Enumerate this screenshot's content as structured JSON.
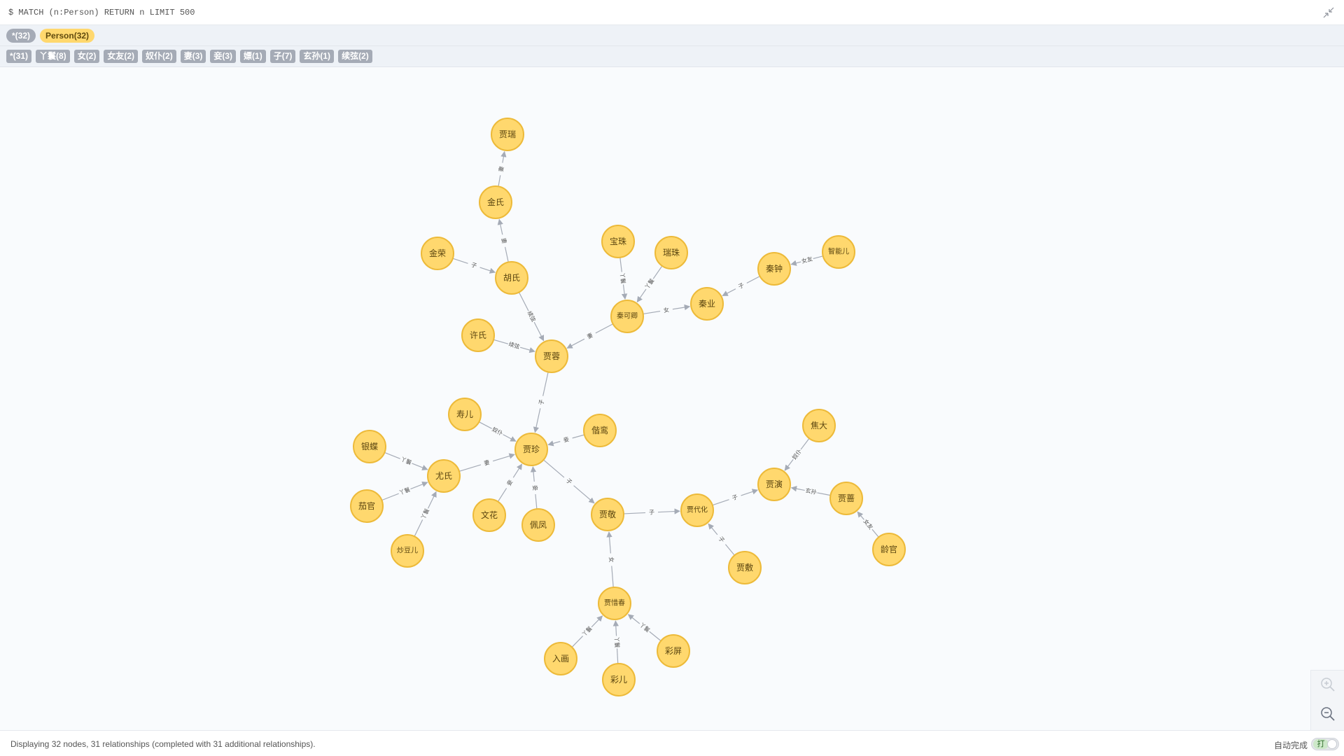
{
  "query": {
    "text": "$ MATCH (n:Person) RETURN n LIMIT 500"
  },
  "labels": [
    {
      "text": "*(32)",
      "kind": "all"
    },
    {
      "text": "Person(32)",
      "kind": "person"
    }
  ],
  "relationship_types": [
    "*(31)",
    "丫鬟(8)",
    "女(2)",
    "女友(2)",
    "奴仆(2)",
    "妻(3)",
    "妾(3)",
    "嫖(1)",
    "子(7)",
    "玄孙(1)",
    "续弦(2)"
  ],
  "graph": {
    "node_color": "#ffd86e",
    "node_border_color": "#edba39",
    "edge_color": "#a5abb6",
    "nodes": [
      {
        "id": "jiarui",
        "name": "贾瑞"
      },
      {
        "id": "jinshi",
        "name": "金氏"
      },
      {
        "id": "jinrong",
        "name": "金荣"
      },
      {
        "id": "hushi",
        "name": "胡氏"
      },
      {
        "id": "baozhu",
        "name": "宝珠"
      },
      {
        "id": "ruizhu",
        "name": "瑞珠"
      },
      {
        "id": "zhinenger",
        "name": "智能儿"
      },
      {
        "id": "qinzhong",
        "name": "秦钟"
      },
      {
        "id": "qinye",
        "name": "秦业"
      },
      {
        "id": "qinkeqing",
        "name": "秦可卿"
      },
      {
        "id": "xushi",
        "name": "许氏"
      },
      {
        "id": "jiarong",
        "name": "贾蓉"
      },
      {
        "id": "shouer",
        "name": "寿儿"
      },
      {
        "id": "xieluan",
        "name": "偕鸾"
      },
      {
        "id": "jiazhen",
        "name": "贾珍"
      },
      {
        "id": "yindie",
        "name": "银蝶"
      },
      {
        "id": "youshi",
        "name": "尤氏"
      },
      {
        "id": "jiaoda",
        "name": "焦大"
      },
      {
        "id": "jiayan",
        "name": "贾演"
      },
      {
        "id": "jiaqiang",
        "name": "贾蔷"
      },
      {
        "id": "qieguan",
        "name": "茄官"
      },
      {
        "id": "wenhua",
        "name": "文花"
      },
      {
        "id": "peifeng",
        "name": "佩凤"
      },
      {
        "id": "jiajing",
        "name": "贾敬"
      },
      {
        "id": "jiadaihua",
        "name": "贾代化"
      },
      {
        "id": "lingguan",
        "name": "龄官"
      },
      {
        "id": "chaodouer",
        "name": "炒豆儿"
      },
      {
        "id": "jiafu",
        "name": "贾敷"
      },
      {
        "id": "jiaxichun",
        "name": "贾惜春"
      },
      {
        "id": "ruhua",
        "name": "入画"
      },
      {
        "id": "caiping",
        "name": "彩屏"
      },
      {
        "id": "caier",
        "name": "彩儿"
      }
    ],
    "relationships": [
      {
        "source": "jinshi",
        "target": "jiarui",
        "type": "妻"
      },
      {
        "source": "hushi",
        "target": "jinshi",
        "type": "妻"
      },
      {
        "source": "jinrong",
        "target": "hushi",
        "type": "子"
      },
      {
        "source": "hushi",
        "target": "jiarong",
        "type": "续弦"
      },
      {
        "source": "xushi",
        "target": "jiarong",
        "type": "续弦"
      },
      {
        "source": "baozhu",
        "target": "qinkeqing",
        "type": "丫鬟"
      },
      {
        "source": "ruizhu",
        "target": "qinkeqing",
        "type": "丫鬟"
      },
      {
        "source": "qinkeqing",
        "target": "jiarong",
        "type": "妻"
      },
      {
        "source": "qinkeqing",
        "target": "qinye",
        "type": "女"
      },
      {
        "source": "qinzhong",
        "target": "qinye",
        "type": "子"
      },
      {
        "source": "zhinenger",
        "target": "qinzhong",
        "type": "女友"
      },
      {
        "source": "jiarong",
        "target": "jiazhen",
        "type": "子"
      },
      {
        "source": "shouer",
        "target": "jiazhen",
        "type": "奴仆"
      },
      {
        "source": "xieluan",
        "target": "jiazhen",
        "type": "妾"
      },
      {
        "source": "youshi",
        "target": "jiazhen",
        "type": "妻"
      },
      {
        "source": "wenhua",
        "target": "jiazhen",
        "type": "妾"
      },
      {
        "source": "peifeng",
        "target": "jiazhen",
        "type": "妾"
      },
      {
        "source": "jiazhen",
        "target": "jiajing",
        "type": "子"
      },
      {
        "source": "yindie",
        "target": "youshi",
        "type": "丫鬟"
      },
      {
        "source": "qieguan",
        "target": "youshi",
        "type": "丫鬟"
      },
      {
        "source": "chaodouer",
        "target": "youshi",
        "type": "丫鬟"
      },
      {
        "source": "jiajing",
        "target": "jiadaihua",
        "type": "子"
      },
      {
        "source": "jiadaihua",
        "target": "jiayan",
        "type": "子"
      },
      {
        "source": "jiafu",
        "target": "jiadaihua",
        "type": "子"
      },
      {
        "source": "jiaoda",
        "target": "jiayan",
        "type": "奴仆"
      },
      {
        "source": "jiaqiang",
        "target": "jiayan",
        "type": "玄孙"
      },
      {
        "source": "lingguan",
        "target": "jiaqiang",
        "type": "女友"
      },
      {
        "source": "jiaxichun",
        "target": "jiajing",
        "type": "女"
      },
      {
        "source": "ruhua",
        "target": "jiaxichun",
        "type": "丫鬟"
      },
      {
        "source": "caier",
        "target": "jiaxichun",
        "type": "丫鬟"
      },
      {
        "source": "caiping",
        "target": "jiaxichun",
        "type": "丫鬟"
      }
    ]
  },
  "zoom": {
    "in_icon": "zoom-in-icon",
    "out_icon": "zoom-out-icon"
  },
  "status": {
    "text": "Displaying 32 nodes, 31 relationships (completed with 31 additional relationships).",
    "autocomplete_label": "自动完成",
    "toggle_text": "打"
  }
}
